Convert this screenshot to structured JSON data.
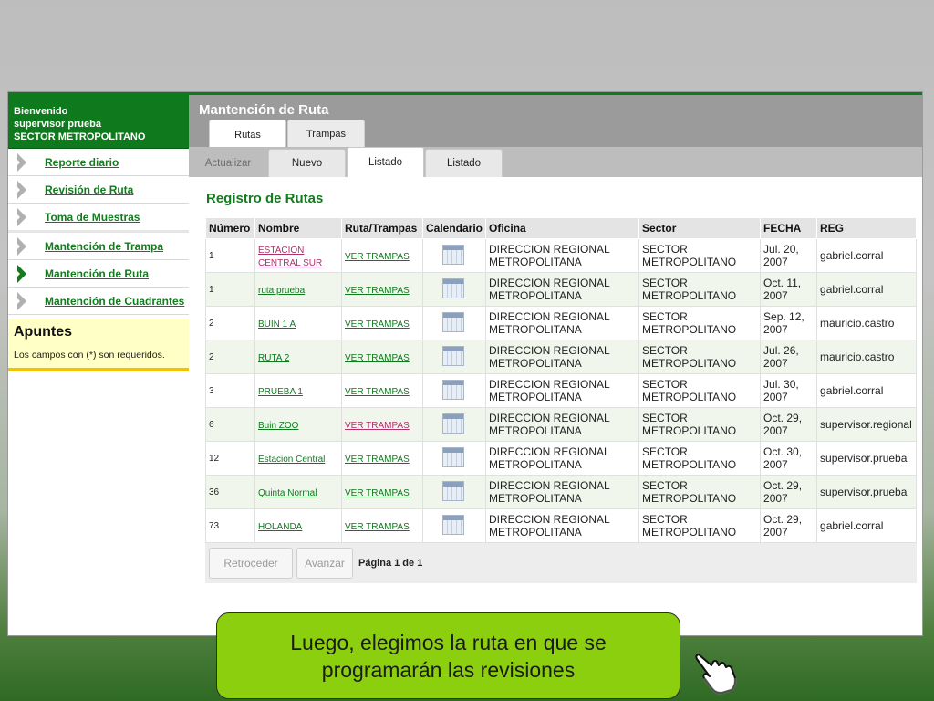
{
  "sidebar": {
    "welcome_lines": [
      "Bienvenido",
      "supervisor prueba",
      "SECTOR METROPOLITANO"
    ],
    "items": [
      {
        "label": "Reporte diario",
        "active": false
      },
      {
        "label": "Revisión de Ruta",
        "active": false
      },
      {
        "label": "Toma de Muestras",
        "active": false
      },
      {
        "label": "Mantención de Trampa",
        "active": false
      },
      {
        "label": "Mantención de Ruta",
        "active": true
      },
      {
        "label": "Mantención de Cuadrantes",
        "active": false
      }
    ],
    "apuntes": {
      "title": "Apuntes",
      "text": "Los campos con (*) son requeridos."
    }
  },
  "header": {
    "title": "Mantención de Ruta",
    "tabs": [
      "Rutas",
      "Trampas"
    ],
    "subtabs": [
      "Actualizar",
      "Nuevo",
      "Listado",
      "Listado"
    ]
  },
  "main": {
    "section_title": "Registro de Rutas",
    "columns": [
      "Número",
      "Nombre",
      "Ruta/Trampas",
      "Calendario",
      "Oficina",
      "Sector",
      "FECHA",
      "REG"
    ],
    "rows": [
      {
        "numero": "1",
        "nombre": "ESTACION CENTRAL SUR",
        "ruta": "VER TRAMPAS",
        "oficina": "DIRECCION REGIONAL METROPOLITANA",
        "sector": "SECTOR METROPOLITANO",
        "fecha": "Jul. 20, 2007",
        "reg": "gabriel.corral"
      },
      {
        "numero": "1",
        "nombre": "ruta prueba",
        "ruta": "VER TRAMPAS",
        "oficina": "DIRECCION REGIONAL METROPOLITANA",
        "sector": "SECTOR METROPOLITANO",
        "fecha": "Oct. 11, 2007",
        "reg": "gabriel.corral"
      },
      {
        "numero": "2",
        "nombre": "BUIN 1 A",
        "ruta": "VER TRAMPAS",
        "oficina": "DIRECCION REGIONAL METROPOLITANA",
        "sector": "SECTOR METROPOLITANO",
        "fecha": "Sep. 12, 2007",
        "reg": "mauricio.castro"
      },
      {
        "numero": "2",
        "nombre": "RUTA 2",
        "ruta": "VER TRAMPAS",
        "oficina": "DIRECCION REGIONAL METROPOLITANA",
        "sector": "SECTOR METROPOLITANO",
        "fecha": "Jul. 26, 2007",
        "reg": "mauricio.castro"
      },
      {
        "numero": "3",
        "nombre": "PRUEBA 1",
        "ruta": "VER TRAMPAS",
        "oficina": "DIRECCION REGIONAL METROPOLITANA",
        "sector": "SECTOR METROPOLITANO",
        "fecha": "Jul. 30, 2007",
        "reg": "gabriel.corral"
      },
      {
        "numero": "6",
        "nombre": "Buin ZOO",
        "ruta": "VER TRAMPAS",
        "oficina": "DIRECCION REGIONAL METROPOLITANA",
        "sector": "SECTOR METROPOLITANO",
        "fecha": "Oct. 29, 2007",
        "reg": "supervisor.regional"
      },
      {
        "numero": "12",
        "nombre": "Estacion Central",
        "ruta": "VER TRAMPAS",
        "oficina": "DIRECCION REGIONAL METROPOLITANA",
        "sector": "SECTOR METROPOLITANO",
        "fecha": "Oct. 30, 2007",
        "reg": "supervisor.prueba"
      },
      {
        "numero": "36",
        "nombre": "Quinta Normal",
        "ruta": "VER TRAMPAS",
        "oficina": "DIRECCION REGIONAL METROPOLITANA",
        "sector": "SECTOR METROPOLITANO",
        "fecha": "Oct. 29, 2007",
        "reg": "supervisor.prueba"
      },
      {
        "numero": "73",
        "nombre": "HOLANDA",
        "ruta": "VER TRAMPAS",
        "oficina": "DIRECCION REGIONAL METROPOLITANA",
        "sector": "SECTOR METROPOLITANO",
        "fecha": "Oct. 29, 2007",
        "reg": "gabriel.corral"
      }
    ],
    "pager": {
      "prev": "Retroceder",
      "next": "Avanzar",
      "info": "Página 1 de 1"
    }
  },
  "callout": {
    "text": "Luego, elegimos la ruta en que se programarán las revisiones"
  },
  "colors": {
    "brand_green": "#0f7a1d",
    "callout_green": "#8bcf0e",
    "visited_link": "#b0306a"
  },
  "icons": {
    "calendar": "calendar-icon",
    "nav": "chevron-right-icon",
    "pointer": "hand-pointer-icon"
  }
}
